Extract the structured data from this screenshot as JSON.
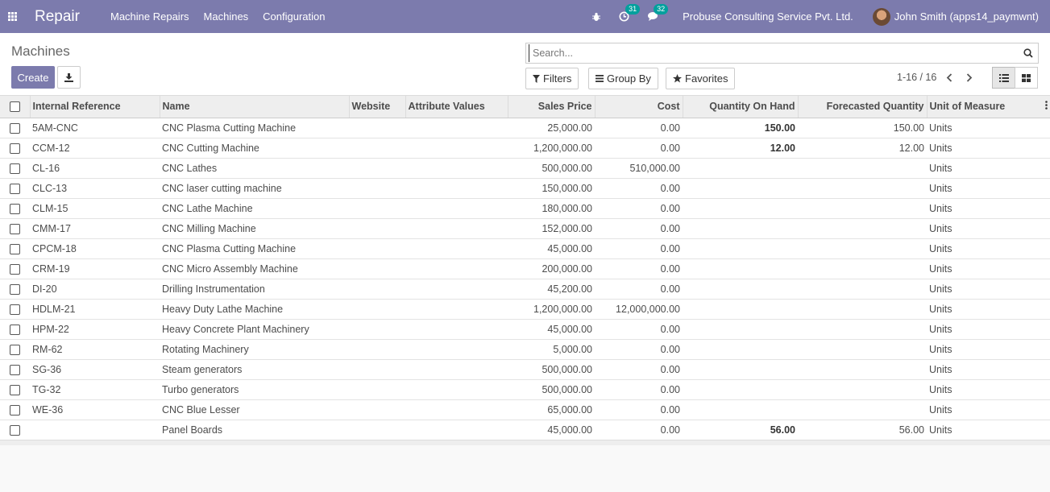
{
  "navbar": {
    "brand": "Repair",
    "menu": [
      "Machine Repairs",
      "Machines",
      "Configuration"
    ],
    "activity_count": "31",
    "message_count": "32",
    "company": "Probuse Consulting Service Pvt. Ltd.",
    "user": "John Smith (apps14_paymwnt)"
  },
  "control_panel": {
    "breadcrumb": "Machines",
    "create_label": "Create",
    "search_placeholder": "Search...",
    "filters_label": "Filters",
    "groupby_label": "Group By",
    "favorites_label": "Favorites",
    "pager_value": "1-16 / 16"
  },
  "table": {
    "headers": [
      "Internal Reference",
      "Name",
      "Website",
      "Attribute Values",
      "Sales Price",
      "Cost",
      "Quantity On Hand",
      "Forecasted Quantity",
      "Unit of Measure"
    ],
    "rows": [
      {
        "ref": "5AM-CNC",
        "name": "CNC Plasma Cutting Machine",
        "price": "25,000.00",
        "cost": "0.00",
        "qty": "150.00",
        "forecast": "150.00",
        "uom": "Units"
      },
      {
        "ref": "CCM-12",
        "name": "CNC Cutting Machine",
        "price": "1,200,000.00",
        "cost": "0.00",
        "qty": "12.00",
        "forecast": "12.00",
        "uom": "Units"
      },
      {
        "ref": "CL-16",
        "name": "CNC Lathes",
        "price": "500,000.00",
        "cost": "510,000.00",
        "qty": "",
        "forecast": "",
        "uom": "Units"
      },
      {
        "ref": "CLC-13",
        "name": "CNC laser cutting machine",
        "price": "150,000.00",
        "cost": "0.00",
        "qty": "",
        "forecast": "",
        "uom": "Units"
      },
      {
        "ref": "CLM-15",
        "name": "CNC Lathe Machine",
        "price": "180,000.00",
        "cost": "0.00",
        "qty": "",
        "forecast": "",
        "uom": "Units"
      },
      {
        "ref": "CMM-17",
        "name": "CNC Milling Machine",
        "price": "152,000.00",
        "cost": "0.00",
        "qty": "",
        "forecast": "",
        "uom": "Units"
      },
      {
        "ref": "CPCM-18",
        "name": "CNC Plasma Cutting Machine",
        "price": "45,000.00",
        "cost": "0.00",
        "qty": "",
        "forecast": "",
        "uom": "Units"
      },
      {
        "ref": "CRM-19",
        "name": "CNC Micro Assembly Machine",
        "price": "200,000.00",
        "cost": "0.00",
        "qty": "",
        "forecast": "",
        "uom": "Units"
      },
      {
        "ref": "DI-20",
        "name": "Drilling Instrumentation",
        "price": "45,200.00",
        "cost": "0.00",
        "qty": "",
        "forecast": "",
        "uom": "Units"
      },
      {
        "ref": "HDLM-21",
        "name": "Heavy Duty Lathe Machine",
        "price": "1,200,000.00",
        "cost": "12,000,000.00",
        "qty": "",
        "forecast": "",
        "uom": "Units"
      },
      {
        "ref": "HPM-22",
        "name": "Heavy Concrete Plant Machinery",
        "price": "45,000.00",
        "cost": "0.00",
        "qty": "",
        "forecast": "",
        "uom": "Units"
      },
      {
        "ref": "RM-62",
        "name": "Rotating Machinery",
        "price": "5,000.00",
        "cost": "0.00",
        "qty": "",
        "forecast": "",
        "uom": "Units"
      },
      {
        "ref": "SG-36",
        "name": "Steam generators",
        "price": "500,000.00",
        "cost": "0.00",
        "qty": "",
        "forecast": "",
        "uom": "Units"
      },
      {
        "ref": "TG-32",
        "name": "Turbo generators",
        "price": "500,000.00",
        "cost": "0.00",
        "qty": "",
        "forecast": "",
        "uom": "Units"
      },
      {
        "ref": "WE-36",
        "name": "CNC Blue Lesser",
        "price": "65,000.00",
        "cost": "0.00",
        "qty": "",
        "forecast": "",
        "uom": "Units"
      },
      {
        "ref": "",
        "name": "Panel Boards",
        "price": "45,000.00",
        "cost": "0.00",
        "qty": "56.00",
        "forecast": "56.00",
        "uom": "Units"
      }
    ]
  }
}
